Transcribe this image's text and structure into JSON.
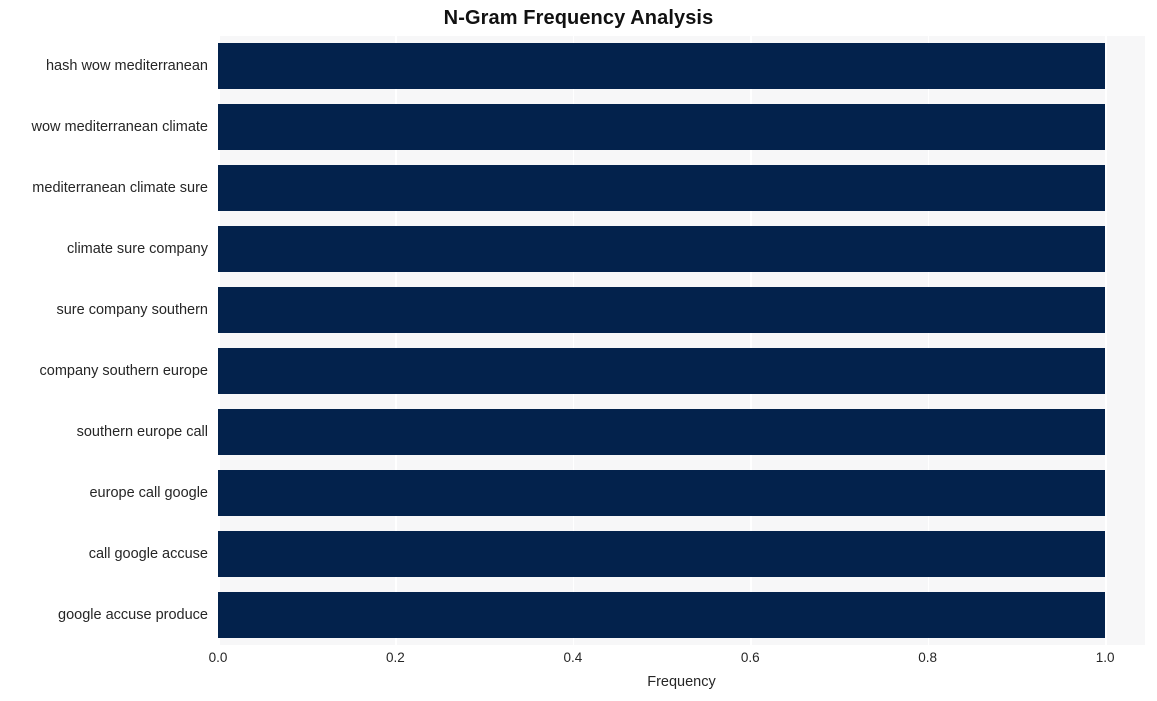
{
  "chart_data": {
    "type": "bar",
    "orientation": "horizontal",
    "title": "N-Gram Frequency Analysis",
    "xlabel": "Frequency",
    "ylabel": "",
    "categories": [
      "hash wow mediterranean",
      "wow mediterranean climate",
      "mediterranean climate sure",
      "climate sure company",
      "sure company southern",
      "company southern europe",
      "southern europe call",
      "europe call google",
      "call google accuse",
      "google accuse produce"
    ],
    "values": [
      1.0,
      1.0,
      1.0,
      1.0,
      1.0,
      1.0,
      1.0,
      1.0,
      1.0,
      1.0
    ],
    "xlim": [
      0.0,
      1.045
    ],
    "xticks": [
      0.0,
      0.2,
      0.4,
      0.6,
      0.8,
      1.0
    ],
    "xtick_labels": [
      "0.0",
      "0.2",
      "0.4",
      "0.6",
      "0.8",
      "1.0"
    ],
    "grid": true,
    "grid_axis": "x",
    "legend": null,
    "bar_color": "#03224c",
    "plot_background": "#f7f7f8",
    "grid_color": "#ffffff",
    "figure_background": "#ffffff",
    "text_color": "#262626",
    "title_color": "#111111"
  }
}
